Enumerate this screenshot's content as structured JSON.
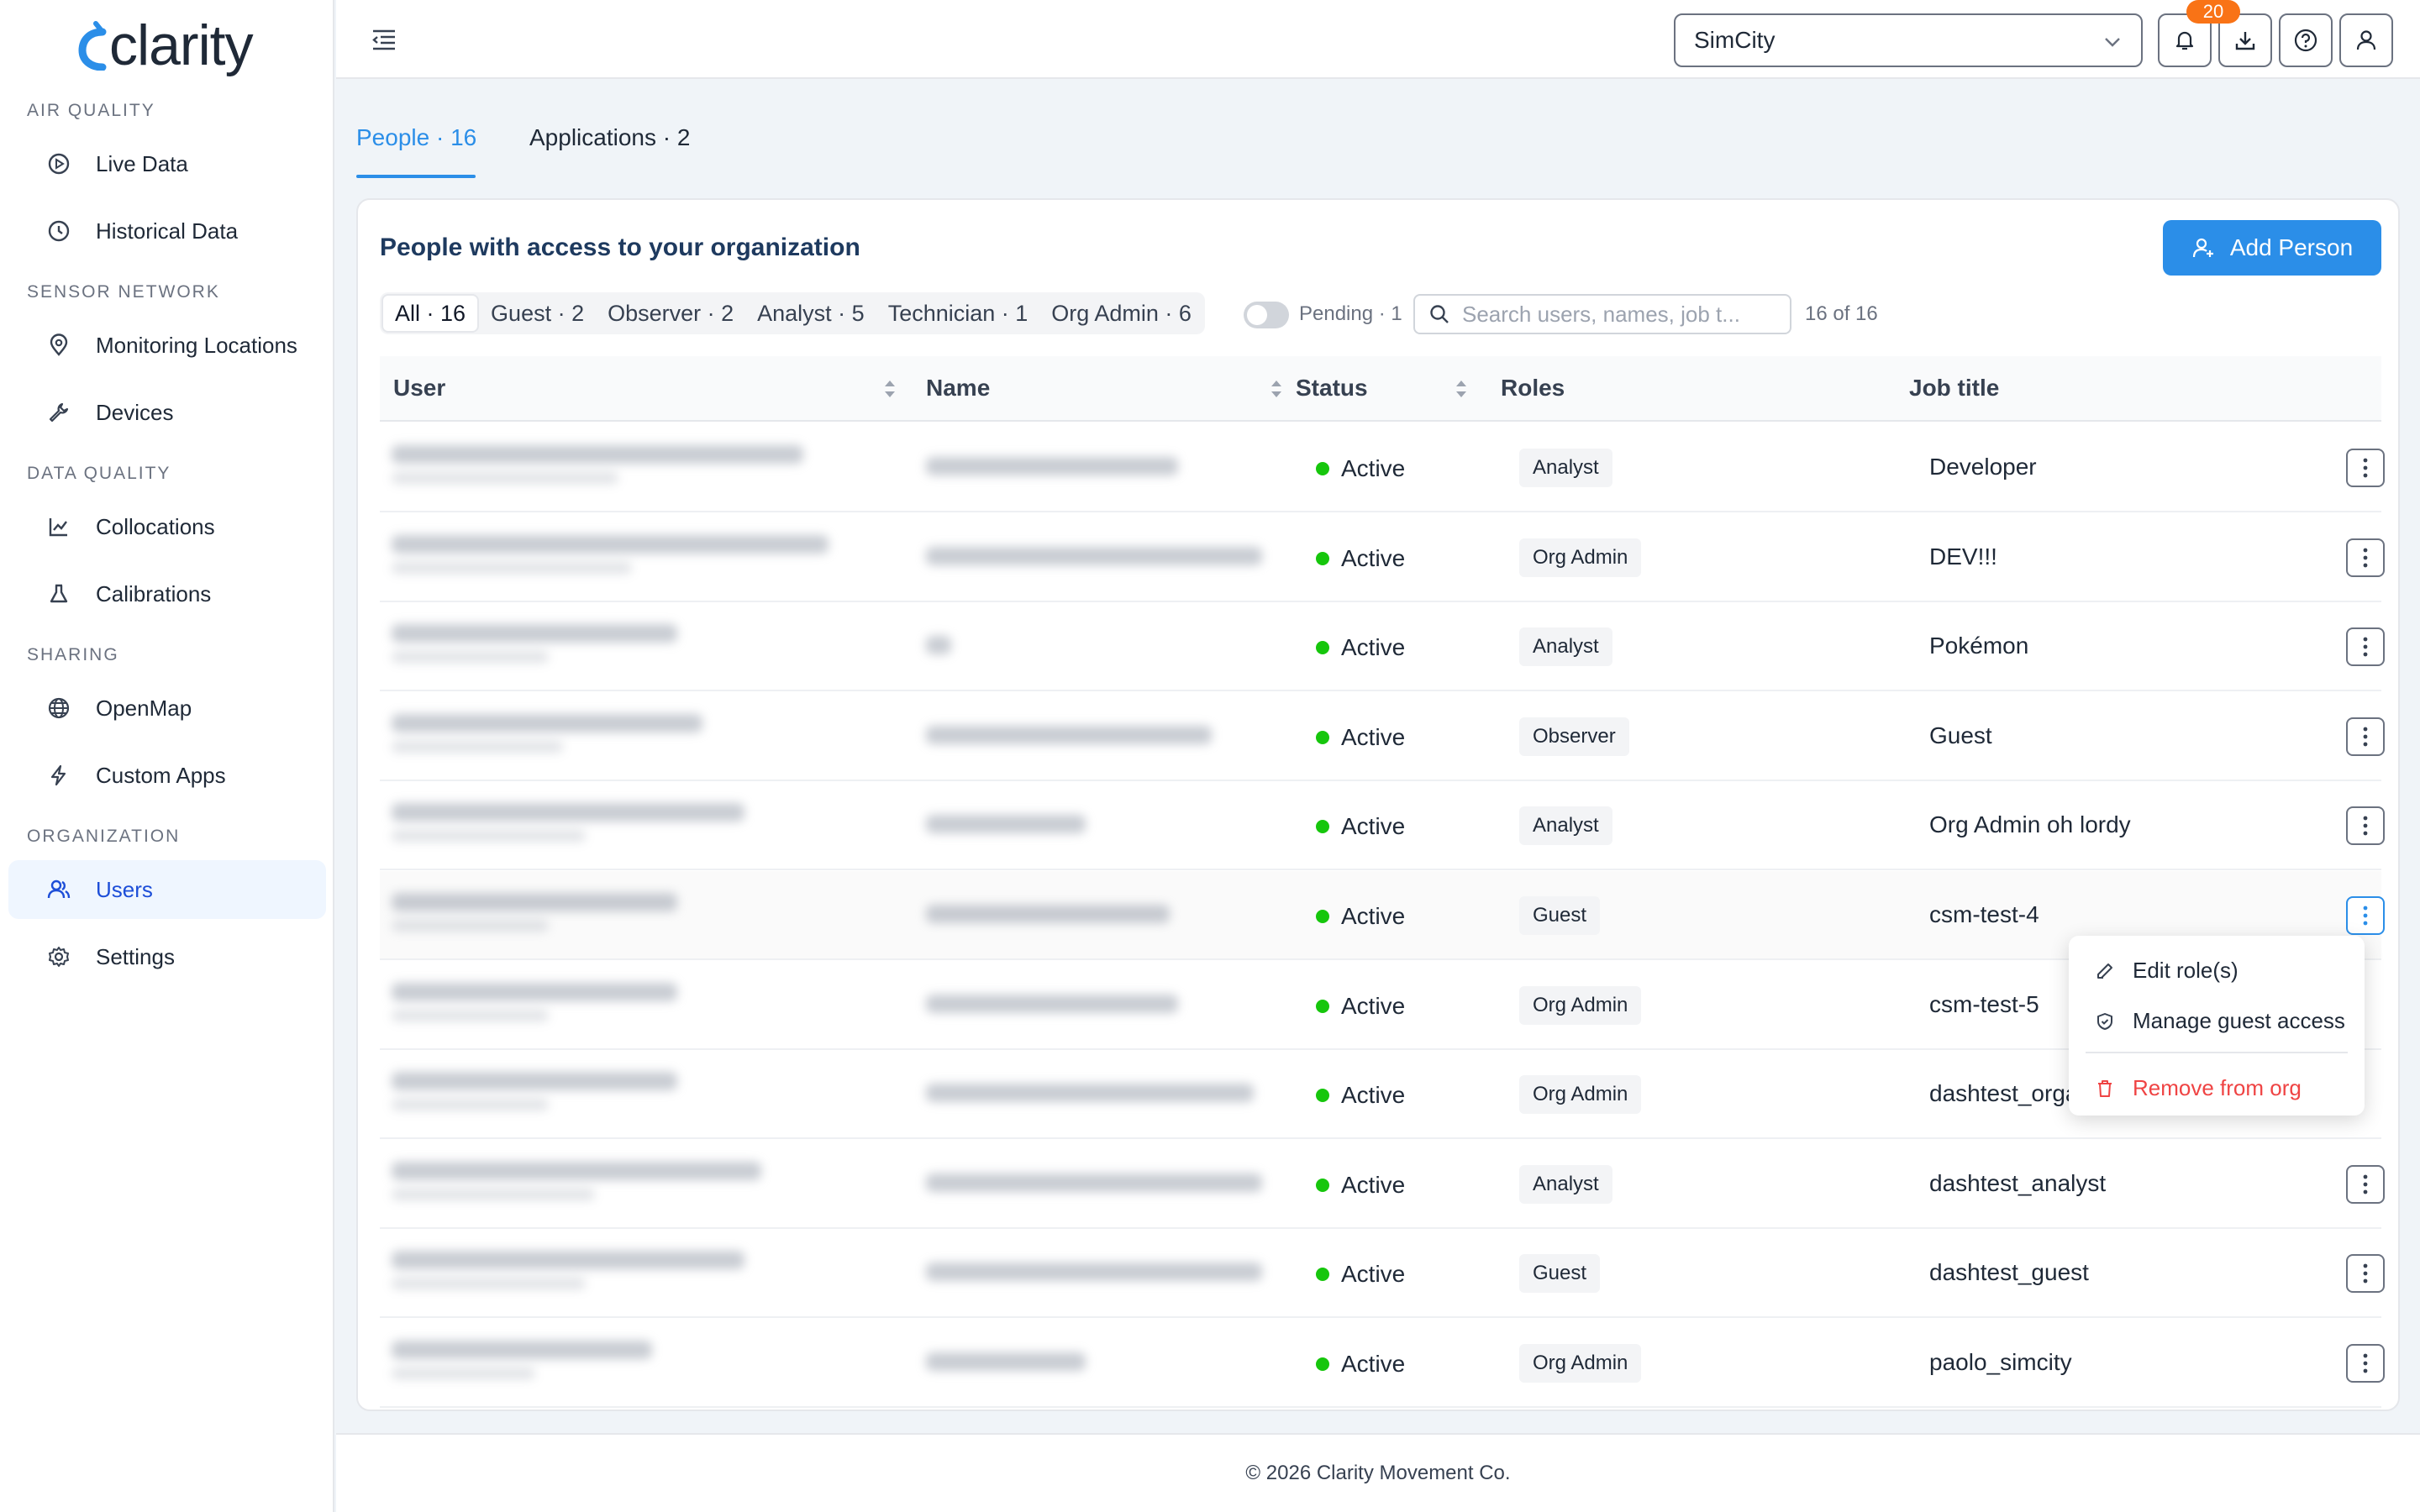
{
  "app": {
    "logo_text": "clarity",
    "brand_color": "#2b8ee8"
  },
  "sidebar": {
    "sections": [
      {
        "label": "AIR QUALITY"
      },
      {
        "label": "SENSOR NETWORK"
      },
      {
        "label": "DATA QUALITY"
      },
      {
        "label": "SHARING"
      },
      {
        "label": "ORGANIZATION"
      }
    ],
    "items": [
      {
        "label": "Live Data",
        "icon": "play-circle-icon"
      },
      {
        "label": "Historical Data",
        "icon": "history-icon"
      },
      {
        "label": "Monitoring Locations",
        "icon": "location-pin-icon"
      },
      {
        "label": "Devices",
        "icon": "wrench-icon"
      },
      {
        "label": "Collocations",
        "icon": "line-chart-icon"
      },
      {
        "label": "Calibrations",
        "icon": "flask-icon"
      },
      {
        "label": "OpenMap",
        "icon": "globe-icon"
      },
      {
        "label": "Custom Apps",
        "icon": "lightning-icon"
      },
      {
        "label": "Users",
        "icon": "users-icon",
        "active": true
      },
      {
        "label": "Settings",
        "icon": "gear-icon"
      }
    ]
  },
  "header": {
    "org_select_value": "SimCity",
    "notification_count": "20"
  },
  "tabs": [
    {
      "label": "People · 16",
      "active": true
    },
    {
      "label": "Applications · 2"
    }
  ],
  "card": {
    "title": "People with access to your organization",
    "add_button_label": "Add Person"
  },
  "filters": {
    "chips": [
      "All · 16",
      "Guest · 2",
      "Observer · 2",
      "Analyst · 5",
      "Technician · 1",
      "Org Admin · 6"
    ],
    "pending_label": "Pending · 1",
    "search_placeholder": "Search users, names, job t...",
    "result_count": "16 of 16"
  },
  "table": {
    "columns": [
      "User",
      "Name",
      "Status",
      "Roles",
      "Job title"
    ],
    "rows": [
      {
        "status": "Active",
        "role": "Analyst",
        "job_title": "Developer"
      },
      {
        "status": "Active",
        "role": "Org Admin",
        "job_title": "DEV!!!"
      },
      {
        "status": "Active",
        "role": "Analyst",
        "job_title": "Pokémon"
      },
      {
        "status": "Active",
        "role": "Observer",
        "job_title": "Guest"
      },
      {
        "status": "Active",
        "role": "Analyst",
        "job_title": "Org Admin oh lordy"
      },
      {
        "status": "Active",
        "role": "Guest",
        "job_title": "csm-test-4"
      },
      {
        "status": "Active",
        "role": "Org Admin",
        "job_title": "csm-test-5"
      },
      {
        "status": "Active",
        "role": "Org Admin",
        "job_title": "dashtest_orgac"
      },
      {
        "status": "Active",
        "role": "Analyst",
        "job_title": "dashtest_analyst"
      },
      {
        "status": "Active",
        "role": "Guest",
        "job_title": "dashtest_guest"
      },
      {
        "status": "Active",
        "role": "Org Admin",
        "job_title": "paolo_simcity"
      }
    ]
  },
  "row_menu": {
    "items": [
      {
        "label": "Edit role(s)",
        "icon": "pencil-icon"
      },
      {
        "label": "Manage guest access",
        "icon": "shield-check-icon"
      },
      {
        "label": "Remove from org",
        "icon": "trash-icon",
        "color": "#ef4444"
      }
    ]
  },
  "footer": {
    "text": "© 2026 Clarity Movement Co."
  }
}
